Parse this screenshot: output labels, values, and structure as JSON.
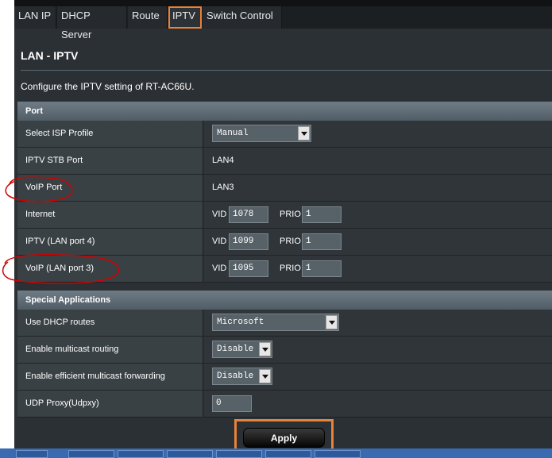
{
  "tabs": [
    {
      "label": "LAN IP"
    },
    {
      "label": "DHCP Server"
    },
    {
      "label": "Route"
    },
    {
      "label": "IPTV",
      "active": true
    },
    {
      "label": "Switch Control"
    }
  ],
  "page": {
    "title": "LAN - IPTV",
    "description": "Configure the IPTV setting of RT-AC66U."
  },
  "port_section": {
    "title": "Port",
    "select_isp_profile": {
      "label": "Select ISP Profile",
      "value": "Manual"
    },
    "iptv_stb_port": {
      "label": "IPTV STB Port",
      "value": "LAN4"
    },
    "voip_port": {
      "label": "VoIP Port",
      "value": "LAN3"
    },
    "internet": {
      "label": "Internet",
      "vid_label": "VID",
      "vid": "1078",
      "prio_label": "PRIO",
      "prio": "1"
    },
    "iptv_lan4": {
      "label": "IPTV (LAN port 4)",
      "vid_label": "VID",
      "vid": "1099",
      "prio_label": "PRIO",
      "prio": "1"
    },
    "voip_lan3": {
      "label": "VoIP (LAN port 3)",
      "vid_label": "VID",
      "vid": "1095",
      "prio_label": "PRIO",
      "prio": "1"
    }
  },
  "special_section": {
    "title": "Special Applications",
    "dhcp_routes": {
      "label": "Use DHCP routes",
      "value": "Microsoft"
    },
    "multicast_routing": {
      "label": "Enable multicast routing",
      "value": "Disable"
    },
    "efficient_multicast": {
      "label": "Enable efficient multicast forwarding",
      "value": "Disable"
    },
    "udp_proxy": {
      "label": "UDP Proxy(Udpxy)",
      "value": "0"
    }
  },
  "actions": {
    "apply_label": "Apply"
  },
  "colors": {
    "highlight": "#e8823a",
    "annotation": "#d40000",
    "background": "#2b3034"
  }
}
